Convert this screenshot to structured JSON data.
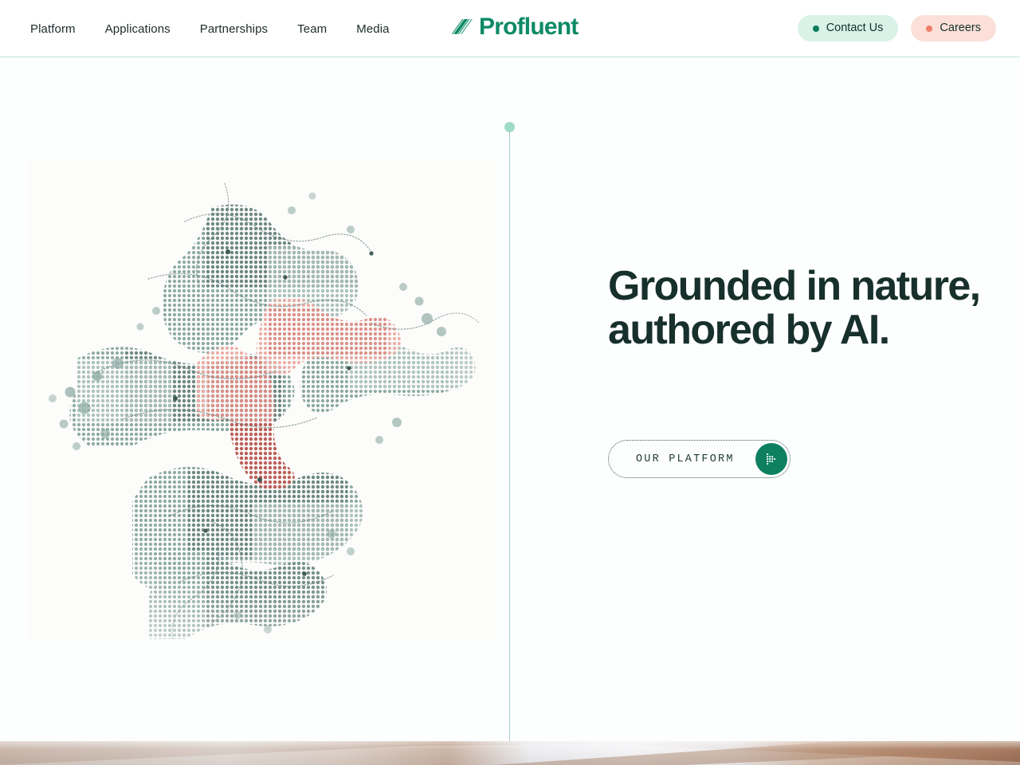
{
  "site": {
    "brand_name": "Profluent",
    "brand_color": "#0d8a66"
  },
  "header": {
    "nav_items": [
      {
        "label": "Platform"
      },
      {
        "label": "Applications"
      },
      {
        "label": "Partnerships"
      },
      {
        "label": "Team"
      },
      {
        "label": "Media"
      }
    ],
    "actions": [
      {
        "label": "Contact Us",
        "dot_color": "#0b7a5c",
        "background": "#d8f2e7"
      },
      {
        "label": "Careers",
        "dot_color": "#ef7f6b",
        "background": "#fbdfd8"
      }
    ]
  },
  "hero": {
    "headline": "Grounded in nature,\nauthored by AI.",
    "headline_color": "#17302b",
    "cta": {
      "label": "OUR PLATFORM",
      "icon": "pixel-arrow-right-icon",
      "circle_color": "#0e8061"
    },
    "artwork": {
      "name": "halftone-protein-structure",
      "primary_color": "#7e9b95",
      "accent_color": "#c4706a",
      "description": "Dotted halftone rendering of a protein ribbon structure in sage green with a red-highlighted motif"
    },
    "divider": {
      "line_color": "#a9cfd0",
      "dot_color": "#9fdcc8"
    }
  },
  "footer_preview": {
    "name": "blurred-photo-strip",
    "description": "Blurred photograph of a wooden desk surface fading in at the bottom of the viewport"
  }
}
